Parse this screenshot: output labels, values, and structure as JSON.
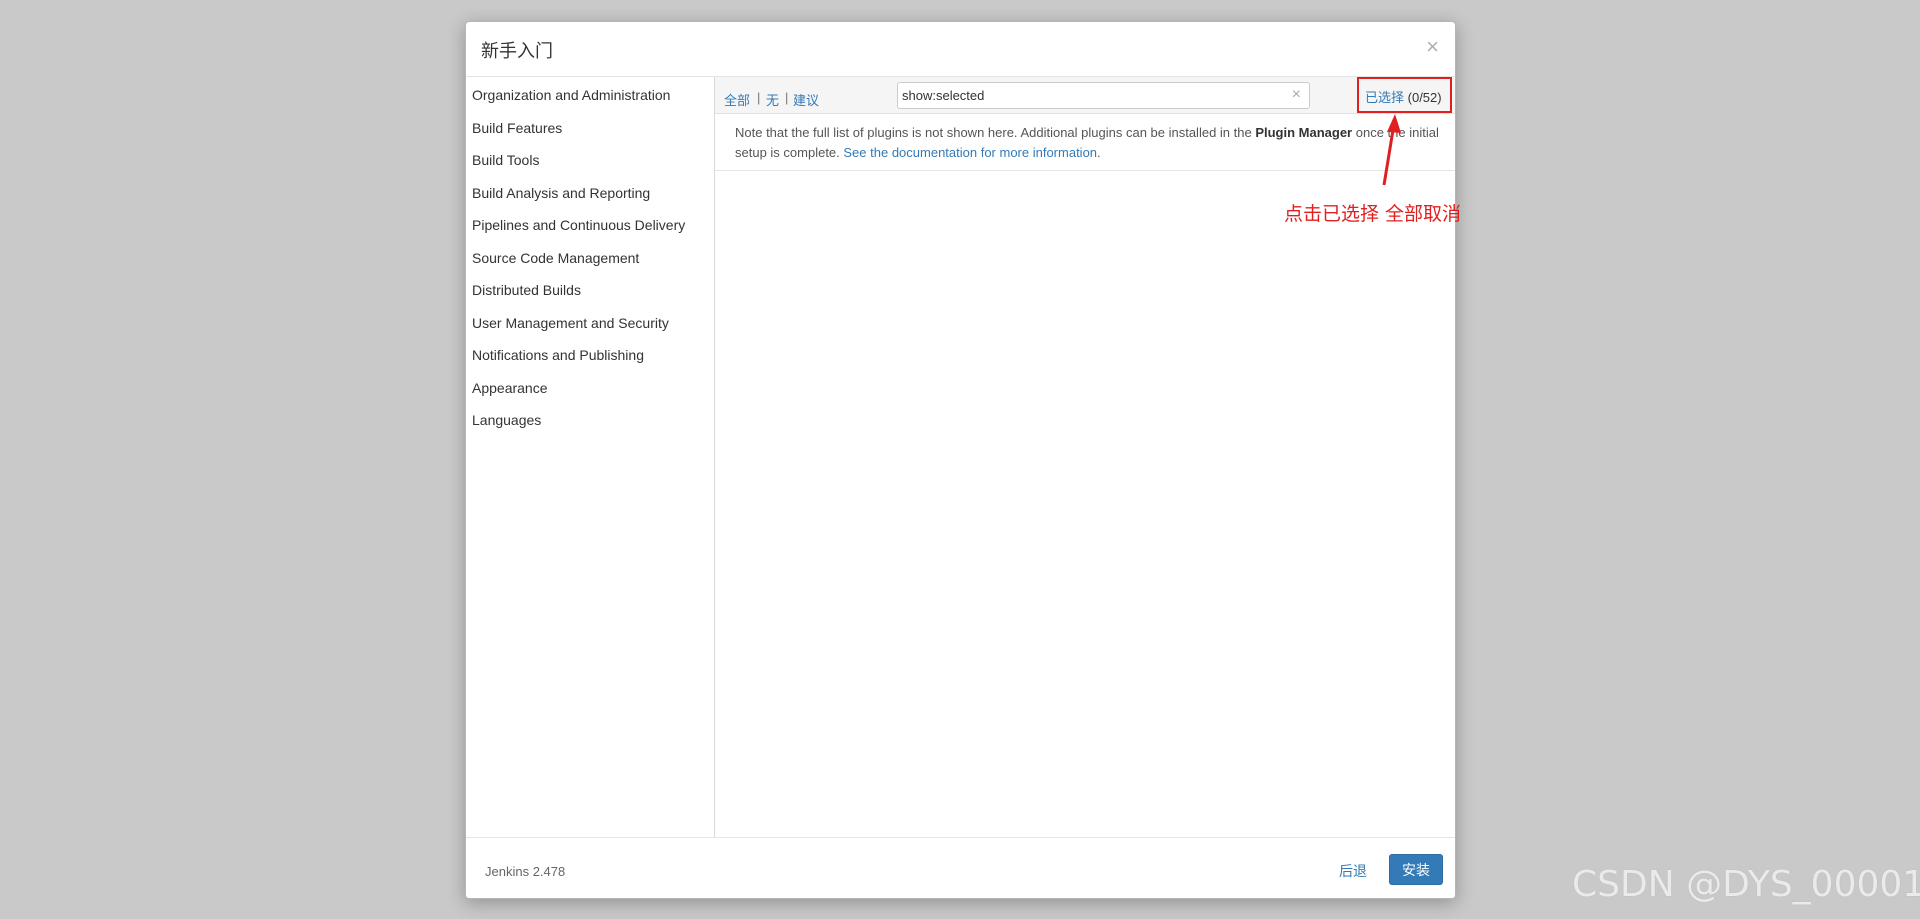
{
  "dialog": {
    "title": "新手入门",
    "close_symbol": "×"
  },
  "sidebar": {
    "categories": [
      "Organization and Administration",
      "Build Features",
      "Build Tools",
      "Build Analysis and Reporting",
      "Pipelines and Continuous Delivery",
      "Source Code Management",
      "Distributed Builds",
      "User Management and Security",
      "Notifications and Publishing",
      "Appearance",
      "Languages"
    ]
  },
  "toolbar": {
    "filter_all": "全部",
    "filter_none": "无",
    "filter_suggested": "建议",
    "separator": "|",
    "search_value": "show:selected",
    "search_clear": "×",
    "selected_label": "已选择",
    "selected_count": "(0/52)"
  },
  "note": {
    "text_before": "Note that the full list of plugins is not shown here. Additional plugins can be installed in the ",
    "plugin_manager": "Plugin Manager",
    "text_after": " once the initial setup is complete. ",
    "doc_link": "See the documentation for more information",
    "period": "."
  },
  "footer": {
    "version": "Jenkins 2.478",
    "back_label": "后退",
    "install_label": "安装"
  },
  "annotation": {
    "text": "点击已选择  全部取消",
    "color": "#e02020"
  },
  "watermark": "CSDN @DYS_00001",
  "colors": {
    "link": "#337ab7",
    "primary_button": "#337ab7",
    "highlight": "#e02020"
  }
}
